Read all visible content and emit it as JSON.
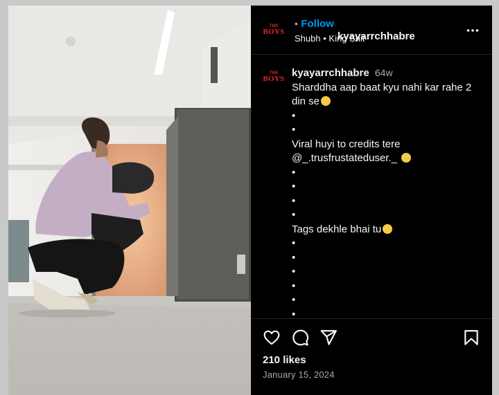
{
  "post": {
    "username": "kyayarrchhabre",
    "follow_label": "Follow",
    "separator": "•",
    "audio_artist": "Shubh",
    "audio_track": "King Shit",
    "avatar_top": "THE",
    "avatar_bottom": "BOYS"
  },
  "caption": {
    "username": "kyayarrchhabre",
    "time": "64w",
    "line1": "Sharddha aap baat kyu nahi kar rahe 2 din se",
    "bullet": "•",
    "line2": "Viral huyi to credits tere",
    "line3": "@_.trusfrustateduser._",
    "line4": "Tags dekhle bhai tu"
  },
  "footer": {
    "likes": "210 likes",
    "date": "January 15, 2024"
  },
  "icons": {
    "like": "heart-icon",
    "comment": "comment-icon",
    "share": "send-icon",
    "save": "bookmark-icon",
    "more": "more-icon"
  },
  "colors": {
    "follow": "#0095f6",
    "muted": "#a8a8a8",
    "brand": "#e2262a"
  }
}
